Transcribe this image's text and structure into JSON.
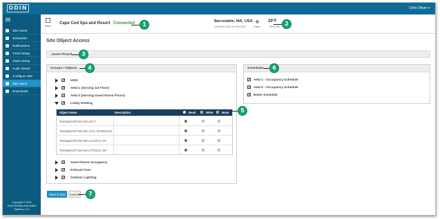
{
  "topbar": {
    "logo": "ODIN",
    "user": "Chris Oliver ▾"
  },
  "sidebar": {
    "items": [
      {
        "label": "Site Home",
        "icon": "home-icon"
      },
      {
        "label": "Schedules",
        "icon": "calendar-icon"
      },
      {
        "label": "Notifications",
        "icon": "bell-icon"
      },
      {
        "label": "Trend Setup",
        "icon": "chart-icon"
      },
      {
        "label": "Alarm Setup",
        "icon": "alarm-icon"
      },
      {
        "label": "Audit Viewer",
        "icon": "audit-icon"
      },
      {
        "label": "Configure Site",
        "icon": "wrench-icon"
      },
      {
        "label": "Site Users",
        "icon": "users-icon",
        "active": true
      },
      {
        "label": "Downloads",
        "icon": "download-icon"
      }
    ],
    "copyright": [
      "Copyright © 2018",
      "ODIN Building Automation",
      "Systems, LLC"
    ]
  },
  "header": {
    "sites_label": "Sites",
    "site_name": "Cape Cod Spa and Resort",
    "status": "Connected",
    "location": "Barnstable, MA, USA",
    "datetime": "01/09/20 4:00:47 PM EST",
    "weather": "Clear",
    "temperature": "29°F",
    "humidity": "40% RH"
  },
  "page": {
    "title": "Site Object Access",
    "user_name": "Jason Pinard",
    "groups_title": "Groups / Objects",
    "schedules_title": "Schedules",
    "save_label": "Save & Exit",
    "cancel_label": "Cancel"
  },
  "groups_before": [
    {
      "label": "HWS",
      "checked": true,
      "expanded": false
    },
    {
      "label": "AHU-1 (Serving 1st Floor)",
      "checked": true,
      "expanded": false
    },
    {
      "label": "AHU-2 (Serving Guest Room Floors)",
      "checked": true,
      "expanded": false
    },
    {
      "label": "Lobby Heating",
      "checked": true,
      "expanded": true
    }
  ],
  "objects_table": {
    "headers": {
      "name": "Object Name",
      "description": "Description",
      "read": "Read",
      "write": "Write",
      "none": "None"
    },
    "rows": [
      {
        "name": "TestingNCE/FCB.VMA.ZN-T",
        "description": "",
        "access": "read"
      },
      {
        "name": "TestingNCE/FCB.VMA.OCC.SCHEDULE",
        "description": "",
        "access": "read"
      },
      {
        "name": "TestingNCE/FCB.VMA.CLGOCC-SP",
        "description": "",
        "access": "read"
      },
      {
        "name": "TestingNCE/FCB.VMA.HTGOCC-SP",
        "description": "",
        "access": "read"
      }
    ]
  },
  "groups_after": [
    {
      "label": "Guest Room Occupancy",
      "checked": true,
      "expanded": false
    },
    {
      "label": "Exhaust Fans",
      "checked": true,
      "expanded": false
    },
    {
      "label": "Outdoor Lighting",
      "checked": true,
      "expanded": false
    }
  ],
  "schedules": [
    {
      "label": "AHU-1 - Occupancy Schedule",
      "checked": true
    },
    {
      "label": "AHU-2 - Occupancy Schedule",
      "checked": true
    },
    {
      "label": "Boiler Schedule",
      "checked": true
    }
  ],
  "callouts": [
    "1",
    "2",
    "3",
    "4",
    "5",
    "6",
    "7"
  ],
  "colors": {
    "accent": "#1f93c9",
    "sidebar": "#0c5a80",
    "table_header": "#173e5e",
    "callout": "#14a86d",
    "connected": "#2a9a2a"
  }
}
